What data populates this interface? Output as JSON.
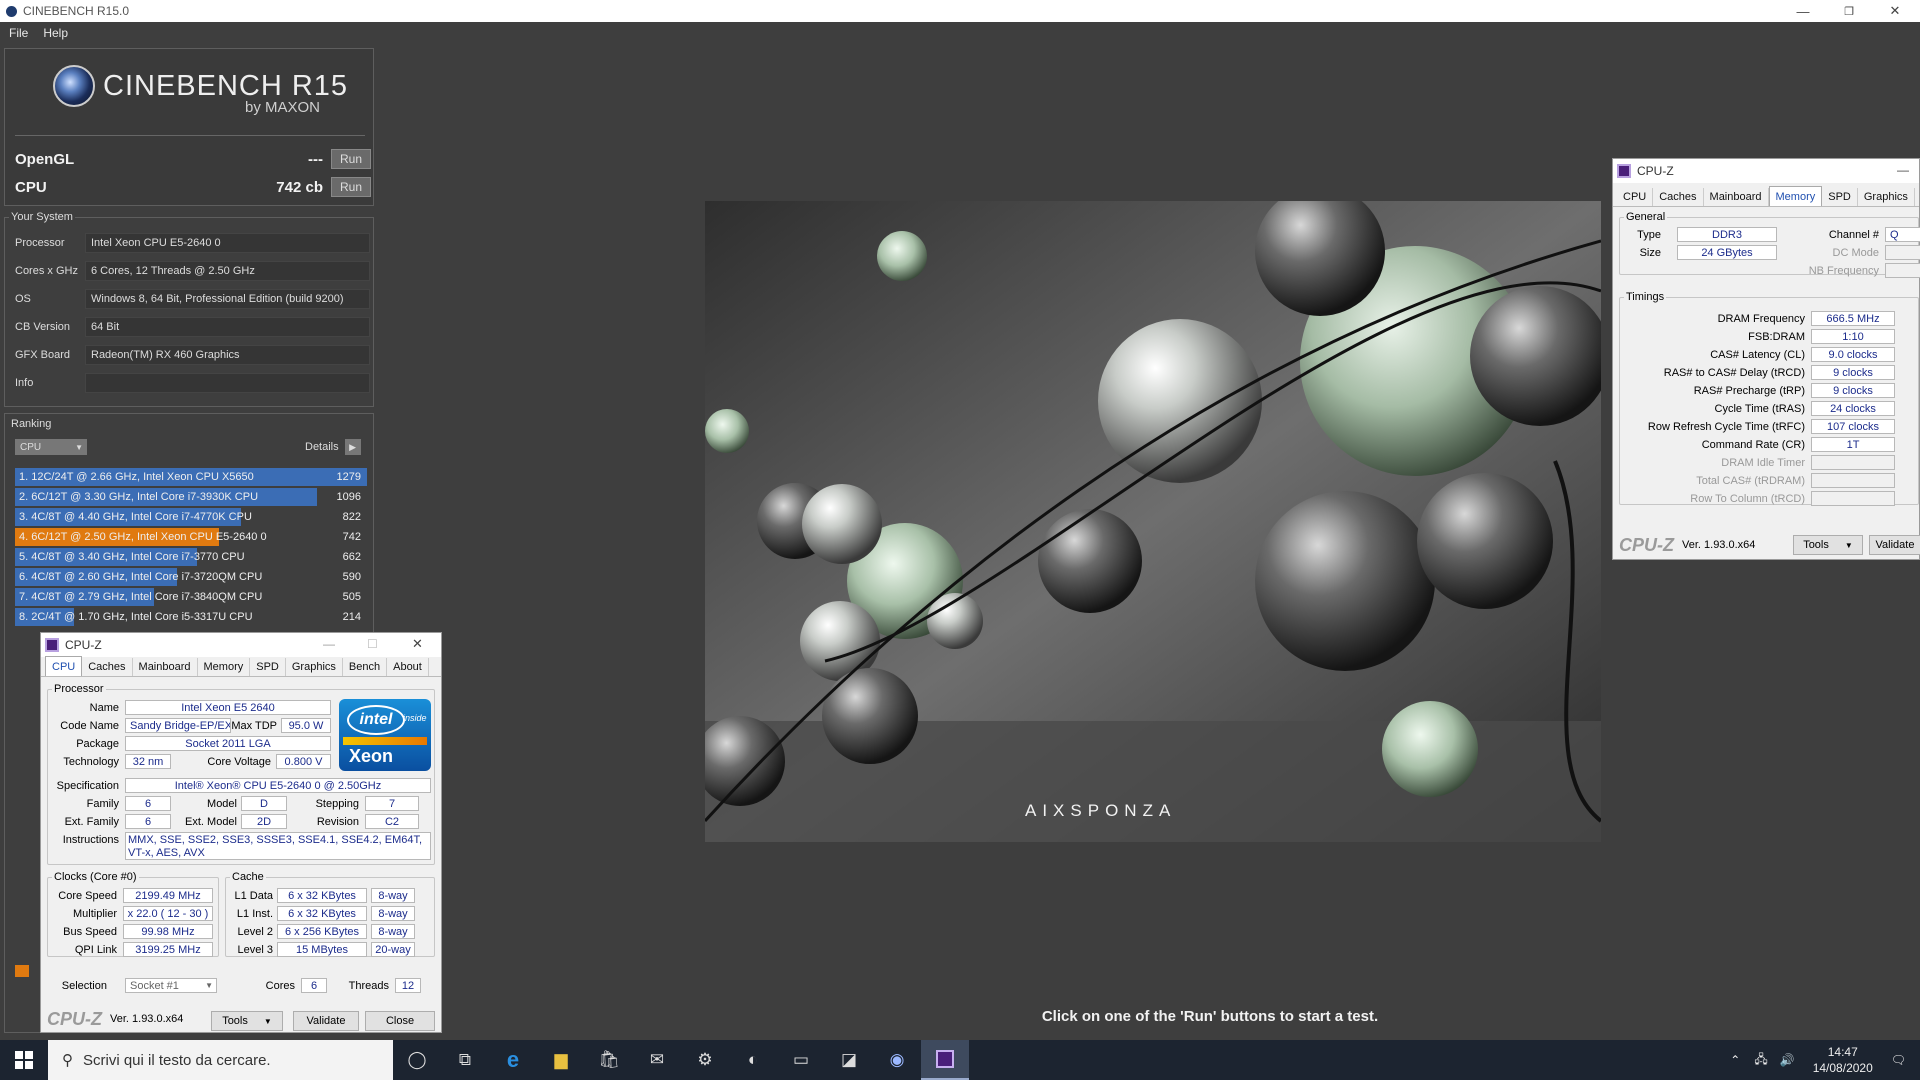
{
  "window": {
    "title": "CINEBENCH R15.0",
    "minimize": "—",
    "restore": "❐",
    "close": "✕"
  },
  "menu": [
    "File",
    "Help"
  ],
  "logo": {
    "title": "CINEBENCH R15",
    "sub": "by MAXON"
  },
  "scores": {
    "opengl": {
      "label": "OpenGL",
      "value": "---",
      "run": "Run"
    },
    "cpu": {
      "label": "CPU",
      "value": "742 cb",
      "run": "Run"
    }
  },
  "your_system": {
    "title": "Your System",
    "rows": [
      {
        "k": "Processor",
        "v": "Intel Xeon CPU E5-2640 0"
      },
      {
        "k": "Cores x GHz",
        "v": "6 Cores, 12 Threads @ 2.50 GHz"
      },
      {
        "k": "OS",
        "v": "Windows 8, 64 Bit, Professional Edition (build 9200)"
      },
      {
        "k": "CB Version",
        "v": "64 Bit"
      },
      {
        "k": "GFX Board",
        "v": "Radeon(TM) RX 460 Graphics"
      },
      {
        "k": "Info",
        "v": ""
      }
    ]
  },
  "ranking": {
    "title": "Ranking",
    "dropdown": "CPU",
    "details": "Details",
    "max_score": 1279,
    "highlight_color": "#e07a10",
    "bar_color": "#3b6db5",
    "items": [
      {
        "text": "1. 12C/24T @ 2.66 GHz, Intel Xeon CPU X5650",
        "score": 1279,
        "mine": false
      },
      {
        "text": "2. 6C/12T @ 3.30 GHz,  Intel Core i7-3930K CPU",
        "score": 1096,
        "mine": false
      },
      {
        "text": "3. 4C/8T @ 4.40 GHz, Intel Core i7-4770K CPU",
        "score": 822,
        "mine": false
      },
      {
        "text": "4. 6C/12T @ 2.50 GHz,  Intel Xeon CPU E5-2640 0",
        "score": 742,
        "mine": true
      },
      {
        "text": "5. 4C/8T @ 3.40 GHz,  Intel Core i7-3770 CPU",
        "score": 662,
        "mine": false
      },
      {
        "text": "6. 4C/8T @ 2.60 GHz, Intel Core i7-3720QM CPU",
        "score": 590,
        "mine": false
      },
      {
        "text": "7. 4C/8T @ 2.79 GHz,  Intel Core i7-3840QM CPU",
        "score": 505,
        "mine": false
      },
      {
        "text": "8. 2C/4T @ 1.70 GHz,  Intel Core i5-3317U CPU",
        "score": 214,
        "mine": false
      }
    ]
  },
  "render": {
    "brand": "AIXSPONZA"
  },
  "hint": "Click on one of the 'Run' buttons to start a test.",
  "cpuz_cpu": {
    "title": "CPU-Z",
    "tabs": [
      "CPU",
      "Caches",
      "Mainboard",
      "Memory",
      "SPD",
      "Graphics",
      "Bench",
      "About"
    ],
    "processor_legend": "Processor",
    "name_lbl": "Name",
    "name": "Intel Xeon E5 2640",
    "codename_lbl": "Code Name",
    "codename": "Sandy Bridge-EP/EX",
    "maxtdp_lbl": "Max TDP",
    "maxtdp": "95.0 W",
    "package_lbl": "Package",
    "package": "Socket 2011 LGA",
    "tech_lbl": "Technology",
    "tech": "32 nm",
    "cv_lbl": "Core Voltage",
    "cv": "0.800 V",
    "spec_lbl": "Specification",
    "spec": "Intel® Xeon® CPU E5-2640 0 @ 2.50GHz",
    "family_lbl": "Family",
    "family": "6",
    "model_lbl": "Model",
    "model": "D",
    "stepping_lbl": "Stepping",
    "stepping": "7",
    "extfam_lbl": "Ext. Family",
    "extfam": "6",
    "extmodel_lbl": "Ext. Model",
    "extmodel": "2D",
    "revision_lbl": "Revision",
    "revision": "C2",
    "instr_lbl": "Instructions",
    "instr": "MMX, SSE, SSE2, SSE3, SSSE3, SSE4.1, SSE4.2, EM64T, VT-x, AES, AVX",
    "logo_brand": "intel",
    "logo_inside": "inside",
    "logo_product": "Xeon",
    "clocks_legend": "Clocks (Core #0)",
    "corespeed_lbl": "Core Speed",
    "corespeed": "2199.49 MHz",
    "mult_lbl": "Multiplier",
    "mult": "x 22.0 ( 12 - 30 )",
    "bus_lbl": "Bus Speed",
    "bus": "99.98 MHz",
    "qpi_lbl": "QPI Link",
    "qpi": "3199.25 MHz",
    "cache_legend": "Cache",
    "l1d_lbl": "L1 Data",
    "l1d": "6 x 32 KBytes",
    "l1d_w": "8-way",
    "l1i_lbl": "L1 Inst.",
    "l1i": "6 x 32 KBytes",
    "l1i_w": "8-way",
    "l2_lbl": "Level 2",
    "l2": "6 x 256 KBytes",
    "l2_w": "8-way",
    "l3_lbl": "Level 3",
    "l3": "15 MBytes",
    "l3_w": "20-way",
    "selection_lbl": "Selection",
    "selection": "Socket #1",
    "cores_lbl": "Cores",
    "cores": "6",
    "threads_lbl": "Threads",
    "threads": "12",
    "brand": "CPU-Z",
    "version": "Ver. 1.93.0.x64",
    "tools": "Tools",
    "validate": "Validate",
    "close": "Close"
  },
  "cpuz_mem": {
    "title": "CPU-Z",
    "tabs": [
      "CPU",
      "Caches",
      "Mainboard",
      "Memory",
      "SPD",
      "Graphics"
    ],
    "general_legend": "General",
    "type_lbl": "Type",
    "type": "DDR3",
    "size_lbl": "Size",
    "size": "24 GBytes",
    "channel_lbl": "Channel #",
    "channel": "Q",
    "dcmode_lbl": "DC Mode",
    "nbfreq_lbl": "NB Frequency",
    "timings_legend": "Timings",
    "timings": [
      {
        "k": "DRAM Frequency",
        "v": "666.5 MHz",
        "dim": false
      },
      {
        "k": "FSB:DRAM",
        "v": "1:10",
        "dim": false
      },
      {
        "k": "CAS# Latency (CL)",
        "v": "9.0 clocks",
        "dim": false
      },
      {
        "k": "RAS# to CAS# Delay (tRCD)",
        "v": "9 clocks",
        "dim": false
      },
      {
        "k": "RAS# Precharge (tRP)",
        "v": "9 clocks",
        "dim": false
      },
      {
        "k": "Cycle Time (tRAS)",
        "v": "24 clocks",
        "dim": false
      },
      {
        "k": "Row Refresh Cycle Time (tRFC)",
        "v": "107 clocks",
        "dim": false
      },
      {
        "k": "Command Rate (CR)",
        "v": "1T",
        "dim": false
      },
      {
        "k": "DRAM Idle Timer",
        "v": "",
        "dim": true
      },
      {
        "k": "Total CAS# (tRDRAM)",
        "v": "",
        "dim": true
      },
      {
        "k": "Row To Column (tRCD)",
        "v": "",
        "dim": true
      }
    ],
    "brand": "CPU-Z",
    "version": "Ver. 1.93.0.x64",
    "tools": "Tools",
    "validate": "Validate"
  },
  "taskbar": {
    "search_placeholder": "Scrivi qui il testo da cercare.",
    "time": "14:47",
    "date": "14/08/2020"
  }
}
